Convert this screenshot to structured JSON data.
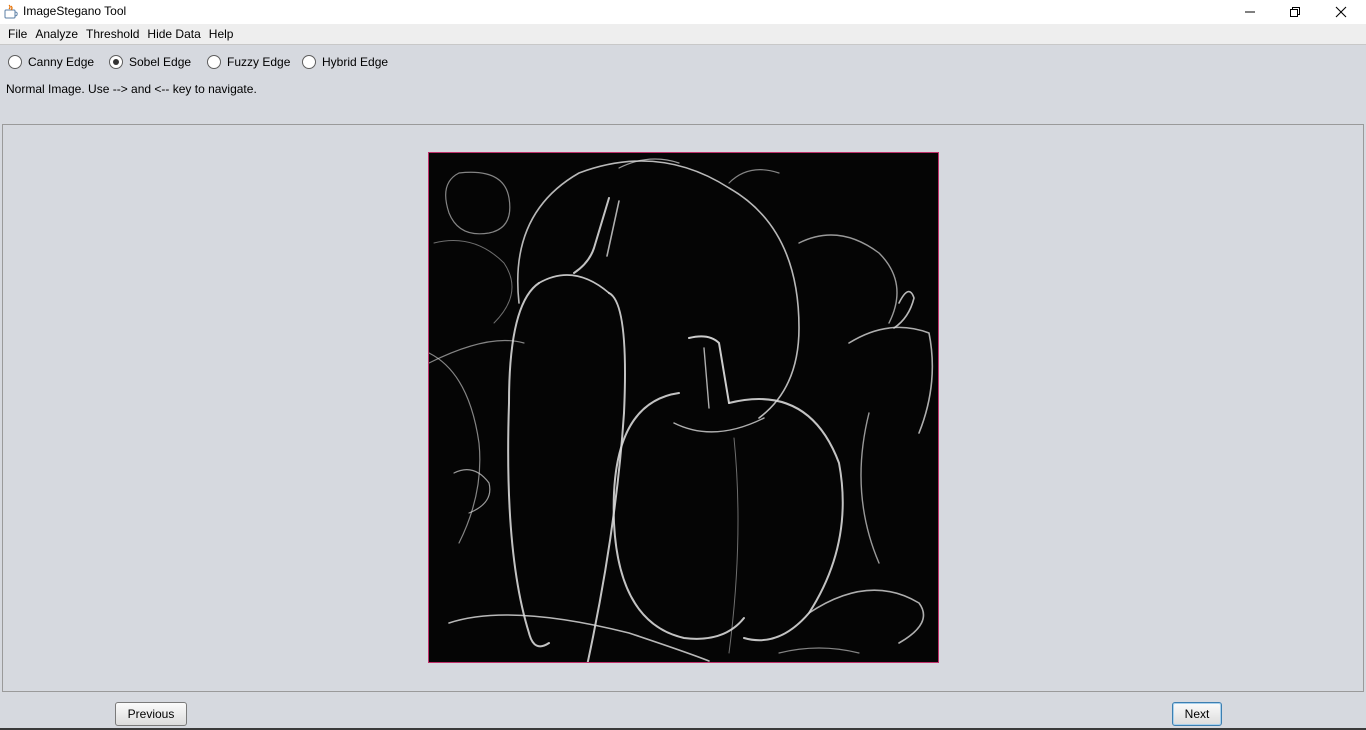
{
  "window": {
    "title": "ImageStegano Tool",
    "controls": [
      "minimize-icon",
      "restore-icon",
      "close-icon"
    ]
  },
  "menubar": {
    "items": [
      {
        "label": "File"
      },
      {
        "label": "Analyze"
      },
      {
        "label": "Threshold"
      },
      {
        "label": "Hide Data"
      },
      {
        "label": "Help"
      }
    ]
  },
  "edge_options": {
    "selected": "Sobel Edge",
    "items": [
      {
        "label": "Canny Edge",
        "checked": false
      },
      {
        "label": "Sobel Edge",
        "checked": true
      },
      {
        "label": "Fuzzy Edge",
        "checked": false
      },
      {
        "label": "Hybrid Edge",
        "checked": false
      }
    ]
  },
  "status": {
    "text": "Normal Image. Use --> and <-- key to navigate."
  },
  "image": {
    "description_icon": "sobel-edge-image",
    "border_color": "#c0306a"
  },
  "buttons": {
    "previous": "Previous",
    "next": "Next"
  },
  "colors": {
    "background": "#d6d9df",
    "menubar": "#eeeeee",
    "accent_focus": "#3c7fb1"
  }
}
